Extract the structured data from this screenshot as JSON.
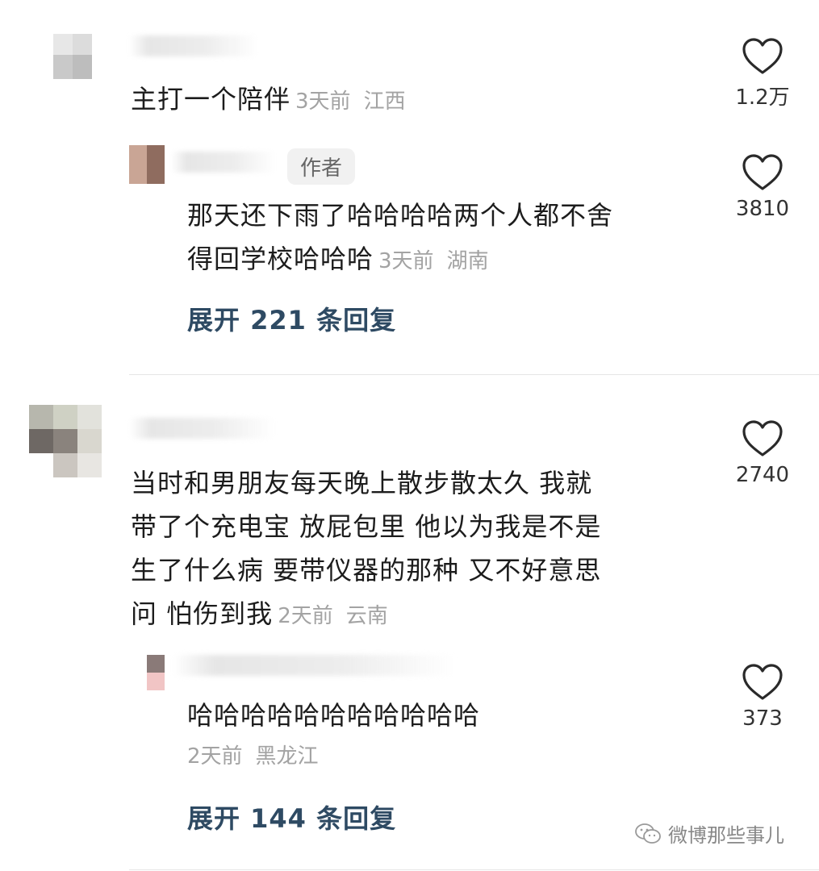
{
  "comments": [
    {
      "text": "主打一个陪伴",
      "time": "3天前",
      "location": "江西",
      "likes": "1.2万",
      "reply": {
        "author_tag": "作者",
        "text_line1": "那天还下雨了哈哈哈哈两个人都不舍",
        "text_line2": "得回学校哈哈哈",
        "time": "3天前",
        "location": "湖南",
        "likes": "3810"
      },
      "expand_label": "展开 221 条回复"
    },
    {
      "text_line1": "当时和男朋友每天晚上散步散太久 我就",
      "text_line2": "带了个充电宝 放屁包里 他以为我是不是",
      "text_line3": "生了什么病 要带仪器的那种 又不好意思",
      "text_line4": "问 怕伤到我",
      "time": "2天前",
      "location": "云南",
      "likes": "2740",
      "reply": {
        "text": "哈哈哈哈哈哈哈哈哈哈哈",
        "time": "2天前",
        "location": "黑龙江",
        "likes": "373"
      },
      "expand_label": "展开 144 条回复"
    }
  ],
  "watermark": {
    "text": "微博那些事儿",
    "icon": "wechat-icon"
  },
  "icons": {
    "like": "heart-outline-icon"
  },
  "colors": {
    "expand": "#2e4a63",
    "meta": "#a3a3a3",
    "text": "#1c1c1c"
  }
}
